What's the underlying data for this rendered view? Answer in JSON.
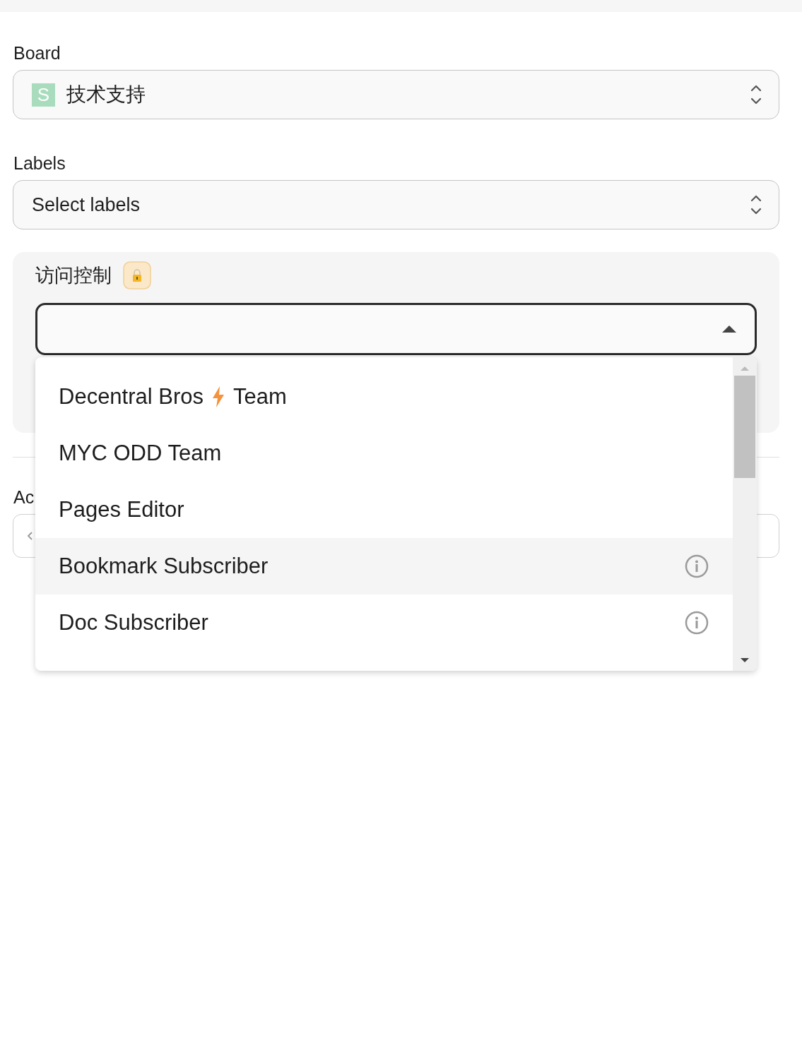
{
  "board": {
    "label": "Board",
    "badge": "S",
    "color": "#a8dcbc",
    "value": "技术支持"
  },
  "labels": {
    "label": "Labels",
    "placeholder": "Select labels"
  },
  "access_control": {
    "title": "访问控制",
    "locked": true,
    "expanded": true,
    "options": [
      {
        "kind": "bolt",
        "label": "Decentral Bros",
        "label_2": "Team",
        "selected": false,
        "info": false
      },
      {
        "kind": "plain",
        "label": "MYC ODD Team",
        "selected": false,
        "info": false
      },
      {
        "kind": "plain",
        "label": "Pages Editor",
        "selected": false,
        "info": false
      },
      {
        "kind": "plain",
        "label": "Bookmark Subscriber",
        "selected": true,
        "info": true
      },
      {
        "kind": "plain",
        "label": "Doc Subscriber",
        "selected": false,
        "info": true
      }
    ]
  },
  "next_section": {
    "label": "Ac"
  }
}
